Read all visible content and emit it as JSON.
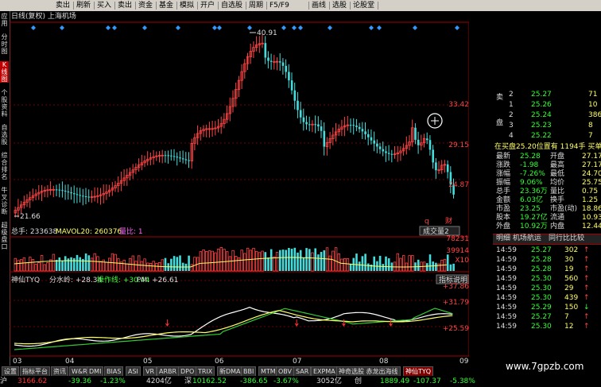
{
  "toolbar": {
    "items": [
      "卖出",
      "刷新",
      "买入",
      "卖出",
      "资金",
      "基金",
      "模拟",
      "开户",
      "自选股",
      "周期",
      "F5/F9",
      "画线",
      "选股",
      "论股堂"
    ]
  },
  "left_nav": [
    "应用",
    "分时图",
    "K线图",
    "个股资料",
    "自选股",
    "综合排名",
    "牛叉诊断",
    "超级盘口"
  ],
  "chart": {
    "title": "日线(复权) 上海机场",
    "max_label": "40.91",
    "min_label": "21.66",
    "price_ticks": [
      "33.42",
      "29.15",
      "24.87"
    ],
    "volume_caption": {
      "total": "总手: 233638",
      "mavol": "MAVOL20: 260376",
      "ratio": "量比: 1"
    },
    "volume_ticks": [
      "78231",
      "39914",
      "X10"
    ],
    "volume_button": "成交量2",
    "indicator_caption": {
      "name": "神仙TYQ",
      "fsl": "分水岭: +28.34",
      "czx": "操作线: +30.44",
      "pm": "PM: +26.61"
    },
    "indicator_button": "指标说明",
    "indicator_ticks": [
      "+37.86",
      "+31.79",
      "+25.59"
    ],
    "months": [
      "03",
      "04",
      "05",
      "06",
      "07",
      "08",
      "09"
    ],
    "q_mark": "q",
    "cai_mark": "财"
  },
  "right_panel": {
    "sell_label": "卖",
    "buy_label": "买",
    "sell": [
      {
        "n": "2",
        "p": "25.27",
        "v": "71"
      },
      {
        "n": "1",
        "p": "25.26",
        "v": "10"
      }
    ],
    "buy": [
      {
        "n": "2",
        "p": "25.24",
        "v": "386"
      },
      {
        "n": "3",
        "p": "25.23",
        "v": "8"
      },
      {
        "n": "4",
        "p": "25.22",
        "v": "7"
      }
    ],
    "buy_label_b": "盘",
    "notice": "在买盘25.20位置有 1194手 买单!更",
    "stats": [
      {
        "k": "最新",
        "v": "25.28",
        "k2": "开盘",
        "v2": "27.17"
      },
      {
        "k": "涨跌",
        "v": "-1.98",
        "k2": "最高",
        "v2": "27.17"
      },
      {
        "k": "涨幅",
        "v": "-7.26%",
        "k2": "最低",
        "v2": "24.70"
      },
      {
        "k": "振幅",
        "v": "9.06%",
        "k2": "均价",
        "v2": "25.75"
      },
      {
        "k": "总手",
        "v": "23.36万",
        "k2": "量比",
        "v2": "0.75"
      },
      {
        "k": "金额",
        "v": "6.03亿",
        "k2": "换手",
        "v2": "1.25"
      },
      {
        "k": "市盈",
        "v": "23.25",
        "k2": "市盈(动)",
        "v2": "18.86"
      },
      {
        "k": "股本",
        "v": "19.27亿",
        "k2": "流通",
        "v2": "10.93亿"
      },
      {
        "k": "外盘",
        "v": "10.92万",
        "k2": "内盘",
        "v2": "12.44万"
      }
    ],
    "tabs": [
      "明细 机场航运",
      "同行比比较"
    ],
    "ticks": [
      {
        "t": "14:59",
        "p": "25.27",
        "v": "302",
        "arrow": "up"
      },
      {
        "t": "14:59",
        "p": "25.28",
        "v": "30",
        "arrow": "up"
      },
      {
        "t": "14:59",
        "p": "25.28",
        "v": "19",
        "arrow": "up"
      },
      {
        "t": "14:59",
        "p": "25.30",
        "v": "560",
        "arrow": "up"
      },
      {
        "t": "14:59",
        "p": "25.30",
        "v": "29",
        "arrow": "up"
      },
      {
        "t": "14:59",
        "p": "25.30",
        "v": "439",
        "arrow": "up"
      },
      {
        "t": "14:59",
        "p": "25.29",
        "v": "150",
        "arrow": "down"
      },
      {
        "t": "14:59",
        "p": "25.27",
        "v": "7",
        "arrow": "up"
      },
      {
        "t": "14:59",
        "p": "25.30",
        "v": "12",
        "arrow": "up"
      }
    ]
  },
  "bottom_tabs": [
    "设置",
    "指标平台",
    "资讯",
    "W&R",
    "DMI",
    "BIAS",
    "ASI",
    "VR",
    "ARBR",
    "DPO",
    "TRIX",
    "新DMA",
    "BBI",
    "MTM",
    "OBV",
    "SAR",
    "EXPMA",
    "神奇选股 赤龙出海线",
    "神仙TYQ"
  ],
  "status": [
    {
      "t": "沪",
      "c": "#ddd"
    },
    {
      "t": "3166.62",
      "c": "#ff3333"
    },
    {
      "t": "-39.36",
      "c": "#33ff33"
    },
    {
      "t": "-1.23%",
      "c": "#33ff33"
    },
    {
      "t": "4204亿",
      "c": "#ddd"
    },
    {
      "t": "深",
      "c": "#ddd"
    },
    {
      "t": "10162.52",
      "c": "#33ff33"
    },
    {
      "t": "-386.65",
      "c": "#33ff33"
    },
    {
      "t": "-3.67%",
      "c": "#33ff33"
    },
    {
      "t": "3052亿",
      "c": "#ddd"
    },
    {
      "t": "创",
      "c": "#ddd"
    },
    {
      "t": "1889.49",
      "c": "#33ff33"
    },
    {
      "t": "-107.37",
      "c": "#33ff33"
    },
    {
      "t": "-5.38%",
      "c": "#33ff33"
    }
  ],
  "watermark": "www.7gpzb.com"
}
